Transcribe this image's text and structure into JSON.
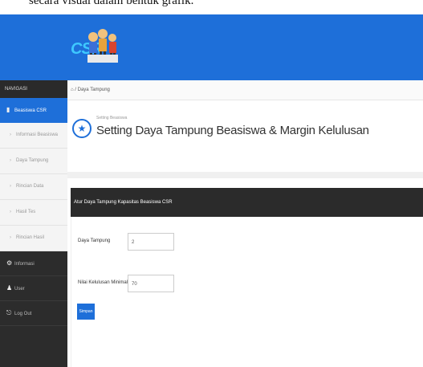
{
  "caption": "secara visual dalam bentuk grafik.",
  "logo_text": "CSR",
  "sidebar": {
    "header": "NAVIGASI",
    "items": [
      {
        "label": "Beasiswa CSR",
        "icon": "user-icon",
        "active": true
      },
      {
        "label": "Informasi Beasiswa",
        "sub": true
      },
      {
        "label": "Daya Tampung",
        "sub": true
      },
      {
        "label": "Rincian Data",
        "sub": true
      },
      {
        "label": "Hasil Tes",
        "sub": true
      },
      {
        "label": "Rincian Hasil",
        "sub": true
      },
      {
        "label": "Informasi",
        "icon": "gear-icon"
      },
      {
        "label": "User",
        "icon": "person-icon"
      },
      {
        "label": "Log Out",
        "icon": "logout-icon"
      }
    ]
  },
  "breadcrumb": "Daya Tampung",
  "page": {
    "subtitle": "Setting Beasiswa",
    "title": "Setting Daya Tampung Beasiswa & Margin Kelulusan"
  },
  "panel": {
    "title": "Atur Daya Tampung Kapasitas Beasiswa CSR",
    "fields": [
      {
        "label": "Daya Tampung",
        "value": "2"
      },
      {
        "label": "Nilai Kelulusan Minimal",
        "value": "70"
      }
    ],
    "submit_label": "Simpan"
  },
  "colors": {
    "primary": "#1e6fd9",
    "sidebar": "#2c2c2c",
    "panel_head": "#2b2b2b"
  }
}
